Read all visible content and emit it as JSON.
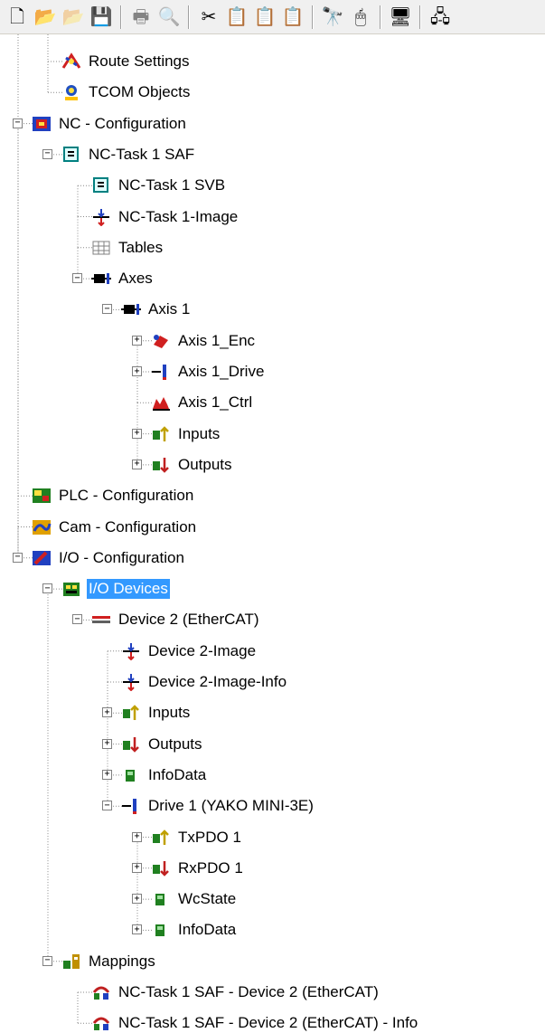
{
  "toolbar": {
    "buttons": [
      {
        "name": "new-file-icon",
        "glyph": "🗋"
      },
      {
        "name": "open-folder-icon",
        "glyph": "📂"
      },
      {
        "name": "open-folder-disabled-icon",
        "glyph": "📂"
      },
      {
        "name": "save-icon",
        "glyph": "💾"
      },
      {
        "name": "print-icon",
        "glyph": "🖶"
      },
      {
        "name": "print-preview-icon",
        "glyph": "🔍"
      },
      {
        "name": "cut-icon",
        "glyph": "✂"
      },
      {
        "name": "copy-icon",
        "glyph": "📋"
      },
      {
        "name": "paste-icon",
        "glyph": "📋"
      },
      {
        "name": "paste-special-icon",
        "glyph": "📋"
      },
      {
        "name": "find-icon",
        "glyph": "🔭"
      },
      {
        "name": "mouse-icon",
        "glyph": "🖱"
      },
      {
        "name": "monitor-icon",
        "glyph": "🖥"
      },
      {
        "name": "network-icon",
        "glyph": "🖧"
      }
    ]
  },
  "tree": {
    "items": [
      {
        "label": "Route Settings",
        "icon": "route-settings-icon",
        "color": "#d02020"
      },
      {
        "label": "TCOM Objects",
        "icon": "tcom-objects-icon",
        "color": "#2050c0"
      },
      {
        "label": "NC - Configuration",
        "icon": "nc-configuration-icon",
        "color": "#8030a0"
      },
      {
        "label": "NC-Task 1 SAF",
        "icon": "nc-task-saf-icon",
        "color": "#00a0a0"
      },
      {
        "label": "NC-Task 1 SVB",
        "icon": "nc-task-svb-icon",
        "color": "#00a0a0"
      },
      {
        "label": "NC-Task 1-Image",
        "icon": "image-icon",
        "color": "#2040c0"
      },
      {
        "label": "Tables",
        "icon": "tables-icon",
        "color": "#808080"
      },
      {
        "label": "Axes",
        "icon": "axes-icon",
        "color": "#000000"
      },
      {
        "label": "Axis 1",
        "icon": "axis-icon",
        "color": "#000000"
      },
      {
        "label": "Axis 1_Enc",
        "icon": "encoder-icon",
        "color": "#d02020"
      },
      {
        "label": "Axis 1_Drive",
        "icon": "drive-icon",
        "color": "#2040c0"
      },
      {
        "label": "Axis 1_Ctrl",
        "icon": "controller-icon",
        "color": "#d02020"
      },
      {
        "label": "Inputs",
        "icon": "inputs-icon",
        "color": "#c0a000"
      },
      {
        "label": "Outputs",
        "icon": "outputs-icon",
        "color": "#c02020"
      },
      {
        "label": "PLC - Configuration",
        "icon": "plc-configuration-icon",
        "color": "#208020"
      },
      {
        "label": "Cam - Configuration",
        "icon": "cam-configuration-icon",
        "color": "#c08000"
      },
      {
        "label": "I/O - Configuration",
        "icon": "io-configuration-icon",
        "color": "#2040c0"
      },
      {
        "label": "I/O Devices",
        "icon": "io-devices-icon",
        "color": "#208020"
      },
      {
        "label": "Device 2 (EtherCAT)",
        "icon": "ethercat-device-icon",
        "color": "#d02020"
      },
      {
        "label": "Device 2-Image",
        "icon": "image-icon",
        "color": "#2040c0"
      },
      {
        "label": "Device 2-Image-Info",
        "icon": "image-info-icon",
        "color": "#2040c0"
      },
      {
        "label": "Inputs",
        "icon": "inputs-icon",
        "color": "#c0a000"
      },
      {
        "label": "Outputs",
        "icon": "outputs-icon",
        "color": "#c02020"
      },
      {
        "label": "InfoData",
        "icon": "infodata-icon",
        "color": "#208020"
      },
      {
        "label": "Drive 1 (YAKO MINI-3E)",
        "icon": "drive-icon",
        "color": "#2040c0"
      },
      {
        "label": "TxPDO 1",
        "icon": "inputs-icon",
        "color": "#c0a000"
      },
      {
        "label": "RxPDO 1",
        "icon": "outputs-icon",
        "color": "#c02020"
      },
      {
        "label": "WcState",
        "icon": "infodata-icon",
        "color": "#208020"
      },
      {
        "label": "InfoData",
        "icon": "infodata-icon",
        "color": "#208020"
      },
      {
        "label": "Mappings",
        "icon": "mappings-icon",
        "color": "#208020"
      },
      {
        "label": "NC-Task 1 SAF - Device 2 (EtherCAT)",
        "icon": "mapping-link-icon",
        "color": "#c02020"
      },
      {
        "label": "NC-Task 1 SAF - Device 2 (EtherCAT) - Info",
        "icon": "mapping-link-icon",
        "color": "#c02020"
      }
    ],
    "selected_label": "I/O Devices"
  }
}
